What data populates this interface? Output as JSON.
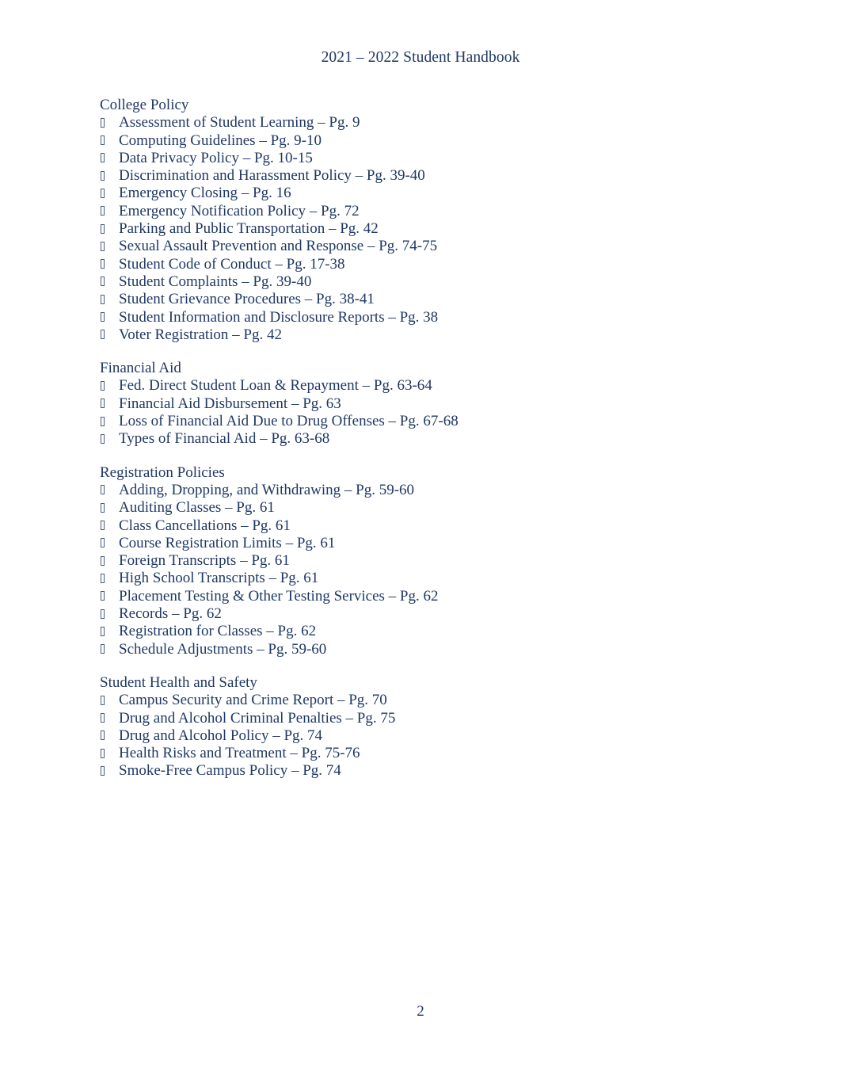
{
  "document": {
    "header_title": "2021 – 2022 Student Handbook",
    "page_number": "2",
    "text_color": "#1f3864",
    "background_color": "#ffffff",
    "bullet_glyph": "missing-glyph-box"
  },
  "sections": [
    {
      "heading": "College Policy",
      "items": [
        "Assessment of Student Learning – Pg. 9",
        "Computing Guidelines – Pg. 9-10",
        "Data Privacy Policy – Pg. 10-15",
        "Discrimination and Harassment Policy – Pg. 39-40",
        "Emergency Closing – Pg. 16",
        "Emergency Notification Policy – Pg. 72",
        "Parking and Public Transportation – Pg. 42",
        "Sexual Assault Prevention and Response – Pg. 74-75",
        "Student Code of Conduct – Pg. 17-38",
        "Student Complaints – Pg. 39-40",
        "Student Grievance Procedures – Pg. 38-41",
        "Student Information and Disclosure Reports – Pg. 38",
        "Voter Registration – Pg. 42"
      ]
    },
    {
      "heading": "Financial Aid",
      "items": [
        "Fed. Direct Student Loan & Repayment – Pg. 63-64",
        "Financial Aid Disbursement – Pg. 63",
        "Loss of Financial Aid Due to Drug Offenses – Pg. 67-68",
        "Types of Financial Aid – Pg. 63-68"
      ]
    },
    {
      "heading": "Registration Policies",
      "items": [
        "Adding, Dropping, and Withdrawing – Pg. 59-60",
        "Auditing Classes – Pg. 61",
        "Class Cancellations – Pg. 61",
        "Course Registration Limits – Pg. 61",
        "Foreign Transcripts – Pg. 61",
        "High School Transcripts – Pg. 61",
        "Placement Testing & Other Testing Services – Pg. 62",
        "Records – Pg. 62",
        "Registration for Classes – Pg. 62",
        "Schedule Adjustments – Pg. 59-60"
      ]
    },
    {
      "heading": "Student Health and Safety",
      "items": [
        "Campus Security and Crime Report – Pg. 70",
        "Drug and Alcohol Criminal Penalties – Pg. 75",
        "Drug and Alcohol Policy – Pg. 74",
        "Health Risks and Treatment – Pg. 75-76",
        "Smoke-Free Campus Policy – Pg. 74"
      ]
    }
  ]
}
